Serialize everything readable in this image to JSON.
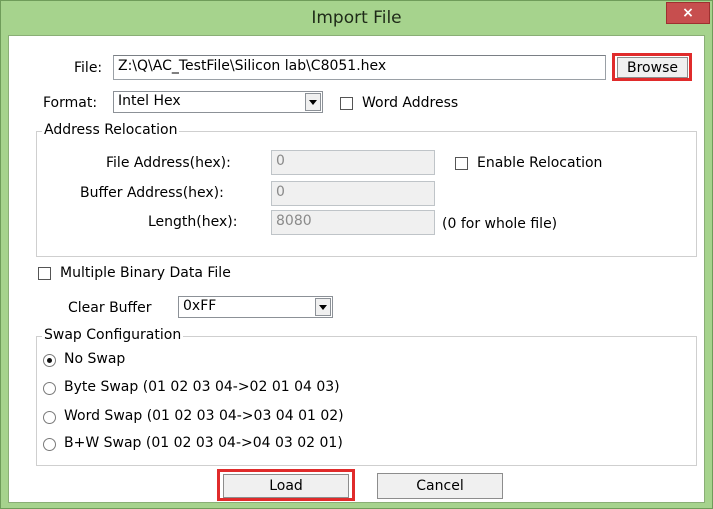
{
  "window": {
    "title": "Import File",
    "close_glyph": "×"
  },
  "file": {
    "label": "File:",
    "path": "Z:\\Q\\AC_TestFile\\Silicon lab\\C8051.hex",
    "browse_label": "Browse"
  },
  "format": {
    "label": "Format:",
    "selected": "Intel Hex",
    "word_address_label": "Word Address",
    "word_address_checked": false
  },
  "relocation": {
    "group_title": "Address Relocation",
    "file_address_label": "File Address(hex):",
    "file_address_value": "0",
    "buffer_address_label": "Buffer Address(hex):",
    "buffer_address_value": "0",
    "length_label": "Length(hex):",
    "length_value": "8080",
    "length_hint": "(0 for whole file)",
    "enable_label": "Enable Relocation",
    "enable_checked": false
  },
  "multiple": {
    "label": "Multiple Binary Data File",
    "checked": false
  },
  "clear_buffer": {
    "label": "Clear Buffer",
    "selected": "0xFF"
  },
  "swap": {
    "group_title": "Swap Configuration",
    "options": [
      {
        "label": "No Swap",
        "selected": true
      },
      {
        "label": "Byte Swap (01 02 03 04->02 01 04 03)",
        "selected": false
      },
      {
        "label": "Word Swap (01 02 03 04->03 04 01 02)",
        "selected": false
      },
      {
        "label": "B+W Swap  (01 02 03 04->04 03 02 01)",
        "selected": false
      }
    ]
  },
  "buttons": {
    "load": "Load",
    "cancel": "Cancel"
  },
  "colors": {
    "frame": "#a6d38d",
    "close": "#c74e4e",
    "highlight": "#e02b2b"
  }
}
